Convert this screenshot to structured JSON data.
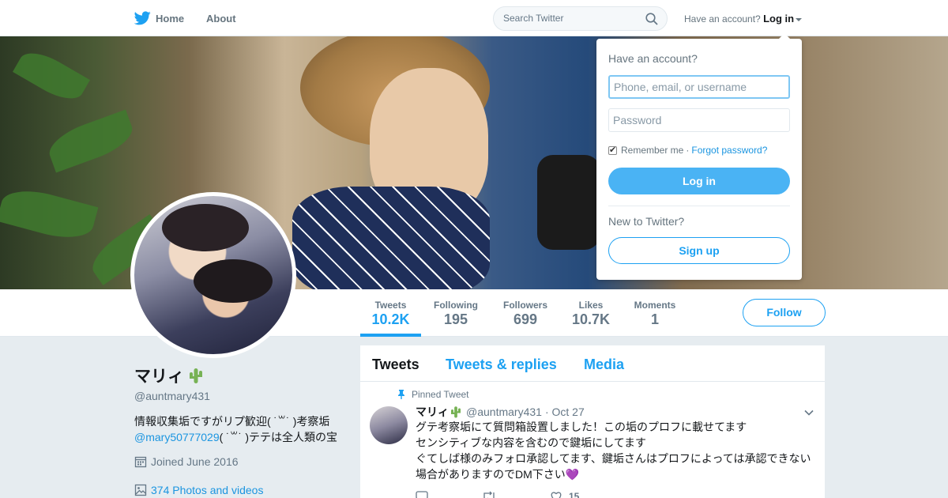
{
  "nav": {
    "home_label": "Home",
    "about_label": "About",
    "search_placeholder": "Search Twitter",
    "have_account_label": "Have an account?",
    "login_label": "Log in"
  },
  "profile": {
    "name": "マリィ",
    "handle": "@auntmary431",
    "bio_line1": "情報収集垢ですがリプ歓迎( ˙꒳˙ )考察垢",
    "bio_mention": "@mary50777029",
    "bio_line2_rest": "( ˙꒳˙ )テテは全人類の宝",
    "joined": "Joined June 2016",
    "photos": "374 Photos and videos"
  },
  "stats": [
    {
      "label": "Tweets",
      "value": "10.2K"
    },
    {
      "label": "Following",
      "value": "195"
    },
    {
      "label": "Followers",
      "value": "699"
    },
    {
      "label": "Likes",
      "value": "10.7K"
    },
    {
      "label": "Moments",
      "value": "1"
    }
  ],
  "follow_label": "Follow",
  "tabs": [
    "Tweets",
    "Tweets & replies",
    "Media"
  ],
  "tweet": {
    "pinned_label": "Pinned Tweet",
    "name": "マリィ",
    "handle": "@auntmary431",
    "date": "· Oct 27",
    "line1": "グテ考察垢にて質問箱設置しました！この垢のプロフに載せてます",
    "line2": "センシティブな内容を含むので鍵垢にしてます",
    "line3": "ぐてしば様のみフォロ承認してます、鍵垢さんはプロフによっては承認できない",
    "line4": "場合がありますのでDM下さい",
    "like_count": "15"
  },
  "login_dropdown": {
    "title": "Have an account?",
    "username_placeholder": "Phone, email, or username",
    "password_placeholder": "Password",
    "remember_label": "Remember me",
    "separator": "·",
    "forgot_label": "Forgot password?",
    "login_button": "Log in",
    "new_label": "New to Twitter?",
    "signup_button": "Sign up"
  },
  "colors": {
    "accent": "#1da1f2",
    "login_button": "#4ab3f4",
    "background": "#e6ecf0",
    "heart": "#9d6ac9"
  }
}
